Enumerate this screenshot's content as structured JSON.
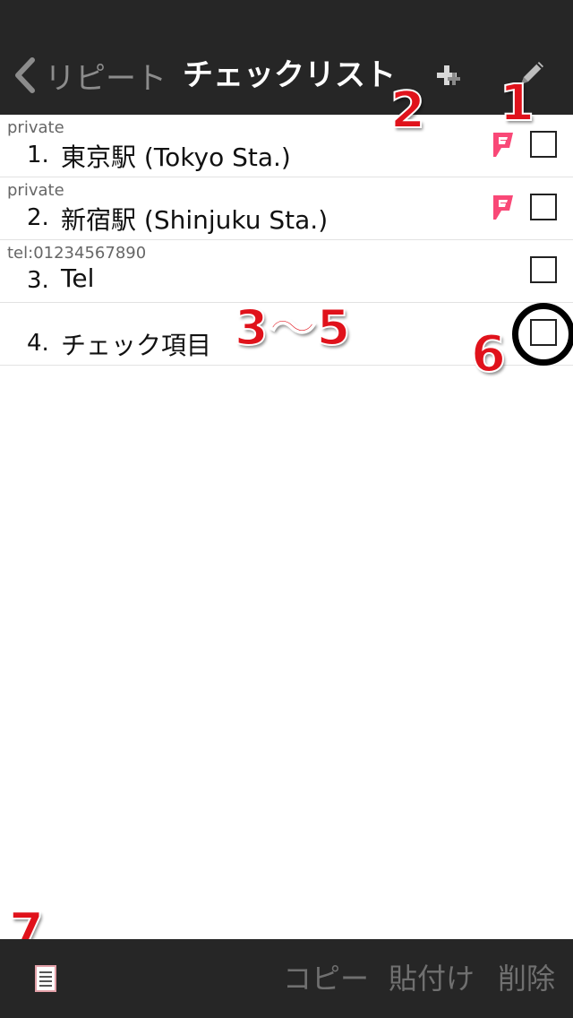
{
  "navbar": {
    "back_label": "リピート",
    "title": "チェックリスト"
  },
  "items": [
    {
      "sub": "private",
      "num": "1.",
      "title": "東京駅 (Tokyo Sta.)",
      "has_foursquare": true,
      "checked": false
    },
    {
      "sub": "private",
      "num": "2.",
      "title": "新宿駅 (Shinjuku Sta.)",
      "has_foursquare": true,
      "checked": false
    },
    {
      "sub": "tel:01234567890",
      "num": "3.",
      "title": "Tel",
      "has_foursquare": false,
      "checked": false
    },
    {
      "sub": "",
      "num": "4.",
      "title": "チェック項目",
      "has_foursquare": false,
      "checked": false
    }
  ],
  "toolbar": {
    "copy_label": "コピー",
    "paste_label": "貼付け",
    "delete_label": "削除"
  },
  "annotations": {
    "a1": "1",
    "a2": "2",
    "a3": "3〜5",
    "a6": "6",
    "a7": "7"
  },
  "icons": {
    "back": "chevron-left-icon",
    "add": "plus-icon",
    "edit": "pencil-icon",
    "foursquare": "foursquare-icon",
    "document": "document-icon"
  },
  "colors": {
    "bar": "#262626",
    "annotation": "#e0121b",
    "foursquare": "#f94877"
  }
}
